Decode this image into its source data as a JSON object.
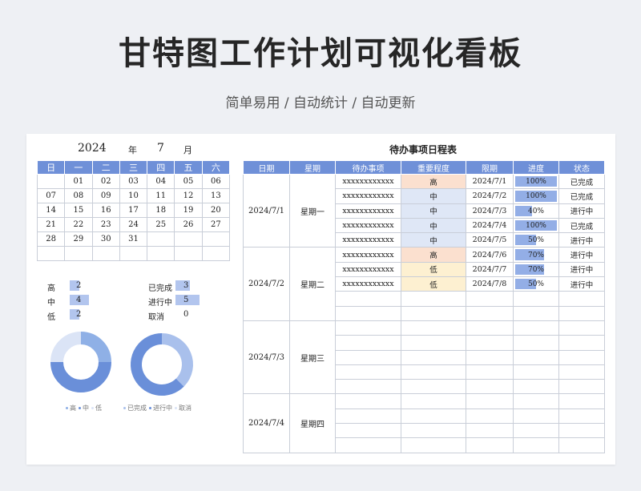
{
  "header": {
    "title": "甘特图工作计划可视化看板",
    "subtitle": "简单易用 / 自动统计 / 自动更新"
  },
  "calendar": {
    "year": "2024",
    "year_label": "年",
    "month": "7",
    "month_label": "月",
    "weekdays": [
      "日",
      "一",
      "二",
      "三",
      "四",
      "五",
      "六"
    ],
    "weeks": [
      [
        "",
        "01",
        "02",
        "03",
        "04",
        "05",
        "06"
      ],
      [
        "07",
        "08",
        "09",
        "10",
        "11",
        "12",
        "13"
      ],
      [
        "14",
        "15",
        "16",
        "17",
        "18",
        "19",
        "20"
      ],
      [
        "21",
        "22",
        "23",
        "24",
        "25",
        "26",
        "27"
      ],
      [
        "28",
        "29",
        "30",
        "31",
        "",
        "",
        ""
      ],
      [
        "",
        "",
        "",
        "",
        "",
        "",
        ""
      ]
    ]
  },
  "stats": {
    "priority": [
      {
        "label": "高",
        "value": "2"
      },
      {
        "label": "中",
        "value": "4"
      },
      {
        "label": "低",
        "value": "2"
      }
    ],
    "status": [
      {
        "label": "已完成",
        "value": "3"
      },
      {
        "label": "进行中",
        "value": "5"
      },
      {
        "label": "取消",
        "value": "0"
      }
    ]
  },
  "charts": {
    "priority_legend": [
      "高",
      "中",
      "低"
    ],
    "status_legend": [
      "已完成",
      "进行中",
      "取消"
    ],
    "priority_colors": [
      "#8fb0e6",
      "#6a8fd9",
      "#dbe4f6"
    ],
    "status_colors": [
      "#a9c0ec",
      "#6a8fd9",
      "#dbe4f6"
    ]
  },
  "schedule": {
    "title": "待办事项日程表",
    "columns": [
      "日期",
      "星期",
      "待办事项",
      "重要程度",
      "限期",
      "进度",
      "状态"
    ],
    "groups": [
      {
        "date": "2024/7/1",
        "weekday": "星期一",
        "rows": [
          {
            "task": "xxxxxxxxxxxx",
            "priority": "高",
            "deadline": "2024/7/1",
            "progress": "100%",
            "progress_value": 1.0,
            "status": "已完成"
          },
          {
            "task": "xxxxxxxxxxxx",
            "priority": "中",
            "deadline": "2024/7/2",
            "progress": "100%",
            "progress_value": 1.0,
            "status": "已完成"
          },
          {
            "task": "xxxxxxxxxxxx",
            "priority": "中",
            "deadline": "2024/7/3",
            "progress": "40%",
            "progress_value": 0.4,
            "status": "进行中"
          },
          {
            "task": "xxxxxxxxxxxx",
            "priority": "中",
            "deadline": "2024/7/4",
            "progress": "100%",
            "progress_value": 1.0,
            "status": "已完成"
          },
          {
            "task": "xxxxxxxxxxxx",
            "priority": "中",
            "deadline": "2024/7/5",
            "progress": "50%",
            "progress_value": 0.5,
            "status": "进行中"
          }
        ]
      },
      {
        "date": "2024/7/2",
        "weekday": "星期二",
        "rows": [
          {
            "task": "xxxxxxxxxxxx",
            "priority": "高",
            "deadline": "2024/7/6",
            "progress": "70%",
            "progress_value": 0.7,
            "status": "进行中"
          },
          {
            "task": "xxxxxxxxxxxx",
            "priority": "低",
            "deadline": "2024/7/7",
            "progress": "70%",
            "progress_value": 0.7,
            "status": "进行中"
          },
          {
            "task": "xxxxxxxxxxxx",
            "priority": "低",
            "deadline": "2024/7/8",
            "progress": "50%",
            "progress_value": 0.5,
            "status": "进行中"
          },
          {
            "task": "",
            "priority": "",
            "deadline": "",
            "progress": "",
            "progress_value": 0,
            "status": ""
          },
          {
            "task": "",
            "priority": "",
            "deadline": "",
            "progress": "",
            "progress_value": 0,
            "status": ""
          }
        ]
      },
      {
        "date": "2024/7/3",
        "weekday": "星期三",
        "rows": [
          {
            "task": "",
            "priority": "",
            "deadline": "",
            "progress": "",
            "progress_value": 0,
            "status": ""
          },
          {
            "task": "",
            "priority": "",
            "deadline": "",
            "progress": "",
            "progress_value": 0,
            "status": ""
          },
          {
            "task": "",
            "priority": "",
            "deadline": "",
            "progress": "",
            "progress_value": 0,
            "status": ""
          },
          {
            "task": "",
            "priority": "",
            "deadline": "",
            "progress": "",
            "progress_value": 0,
            "status": ""
          },
          {
            "task": "",
            "priority": "",
            "deadline": "",
            "progress": "",
            "progress_value": 0,
            "status": ""
          }
        ]
      },
      {
        "date": "2024/7/4",
        "weekday": "星期四",
        "rows": [
          {
            "task": "",
            "priority": "",
            "deadline": "",
            "progress": "",
            "progress_value": 0,
            "status": ""
          },
          {
            "task": "",
            "priority": "",
            "deadline": "",
            "progress": "",
            "progress_value": 0,
            "status": ""
          },
          {
            "task": "",
            "priority": "",
            "deadline": "",
            "progress": "",
            "progress_value": 0,
            "status": ""
          },
          {
            "task": "",
            "priority": "",
            "deadline": "",
            "progress": "",
            "progress_value": 0,
            "status": ""
          }
        ]
      }
    ]
  }
}
